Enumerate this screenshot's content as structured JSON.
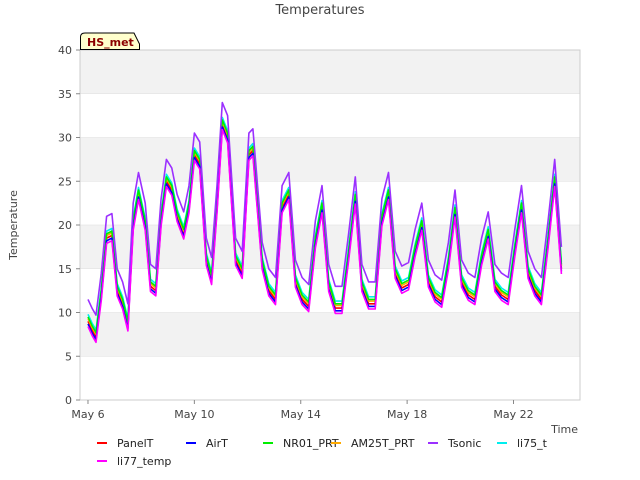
{
  "chart_data": {
    "type": "line",
    "title": "Temperatures",
    "xlabel": "Time",
    "ylabel": "Temperature",
    "badge": "HS_met",
    "xlim": [
      -0.3,
      18.5
    ],
    "ylim": [
      0,
      40
    ],
    "yticks": [
      0,
      5,
      10,
      15,
      20,
      25,
      30,
      35,
      40
    ],
    "xticks": [
      {
        "pos": 0,
        "label": "May 6"
      },
      {
        "pos": 4,
        "label": "May 10"
      },
      {
        "pos": 8,
        "label": "May 14"
      },
      {
        "pos": 12,
        "label": "May 18"
      },
      {
        "pos": 16,
        "label": "May 22"
      }
    ],
    "grid": "horizontal bands",
    "legend": "bottom",
    "colors": {
      "band": "#f2f2f2",
      "grid": "#dddddd",
      "badge_fill": "#ffffcc"
    },
    "reference": {
      "name": "PanelT",
      "x": [
        0.0,
        0.15,
        0.3,
        0.5,
        0.7,
        0.9,
        1.1,
        1.3,
        1.5,
        1.7,
        1.9,
        2.15,
        2.35,
        2.55,
        2.75,
        2.95,
        3.15,
        3.35,
        3.6,
        3.8,
        4.0,
        4.2,
        4.45,
        4.65,
        4.85,
        5.05,
        5.25,
        5.55,
        5.8,
        6.05,
        6.2,
        6.55,
        6.8,
        7.05,
        7.3,
        7.55,
        7.8,
        8.05,
        8.3,
        8.55,
        8.8,
        9.05,
        9.3,
        9.55,
        9.8,
        10.05,
        10.3,
        10.55,
        10.8,
        11.05,
        11.3,
        11.55,
        11.8,
        12.05,
        12.3,
        12.55,
        12.8,
        13.05,
        13.3,
        13.55,
        13.8,
        14.05,
        14.3,
        14.55,
        14.8,
        15.05,
        15.3,
        15.55,
        15.8,
        16.05,
        16.3,
        16.55,
        16.8,
        17.05,
        17.3,
        17.55,
        17.8
      ],
      "y": [
        9.0,
        8.0,
        7.2,
        12.0,
        18.5,
        18.8,
        12.5,
        11.0,
        8.5,
        20.0,
        23.5,
        20.0,
        13.0,
        12.5,
        20.5,
        25.0,
        24.0,
        21.0,
        19.0,
        22.0,
        28.0,
        27.0,
        16.0,
        13.8,
        22.0,
        31.5,
        30.0,
        16.0,
        14.5,
        28.0,
        28.5,
        15.5,
        12.5,
        11.5,
        22.0,
        23.5,
        13.5,
        11.5,
        10.7,
        18.0,
        22.0,
        13.0,
        10.5,
        10.5,
        16.5,
        23.0,
        13.0,
        11.0,
        11.0,
        20.5,
        23.5,
        14.5,
        12.8,
        13.2,
        17.0,
        20.0,
        13.5,
        11.8,
        11.2,
        15.5,
        21.5,
        13.5,
        12.0,
        11.5,
        16.0,
        19.0,
        13.0,
        12.0,
        11.5,
        17.0,
        22.0,
        14.5,
        12.5,
        11.5,
        18.0,
        25.0,
        15.0
      ]
    },
    "series": [
      {
        "name": "PanelT",
        "color": "#ff0000",
        "offset": 0.0
      },
      {
        "name": "AirT",
        "color": "#0000ff",
        "offset": -0.3
      },
      {
        "name": "NR01_PRT",
        "color": "#00ee00",
        "offset": 0.5
      },
      {
        "name": "AM25T_PRT",
        "color": "#ffaa00",
        "offset": 0.3
      },
      {
        "name": "Tsonic",
        "color": "#9b30ff",
        "offset": 2.5
      },
      {
        "name": "li75_t",
        "color": "#00eeee",
        "offset": 0.8
      },
      {
        "name": "li77_temp",
        "color": "#ff00ff",
        "offset": -0.6
      }
    ]
  }
}
